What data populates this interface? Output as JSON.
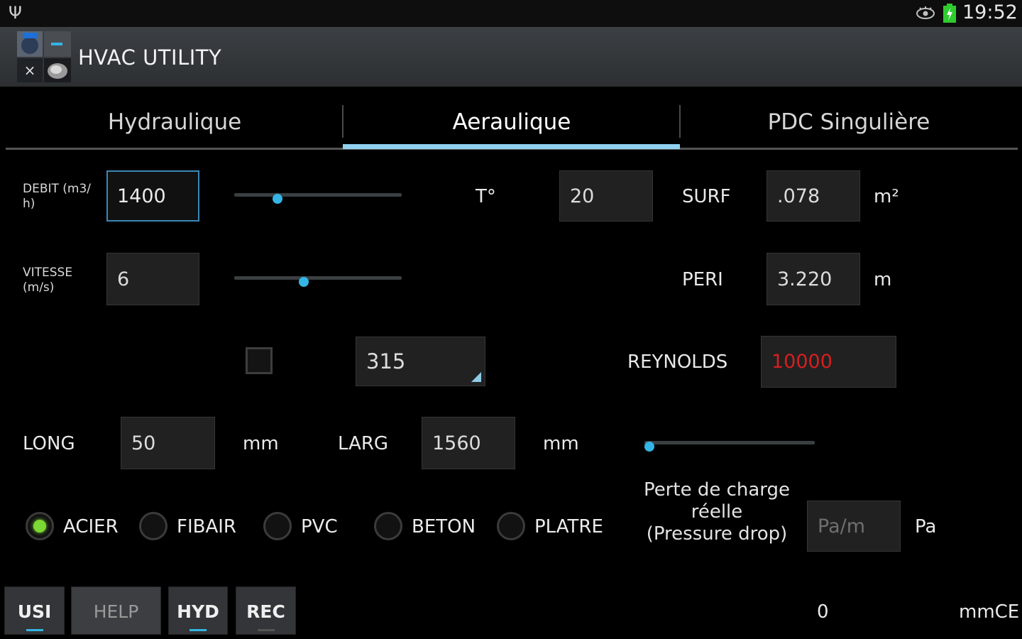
{
  "status": {
    "usb_icon": "usb-icon",
    "clock": "19:52"
  },
  "app": {
    "title": "HVAC UTILITY"
  },
  "tabs": [
    {
      "label": "Hydraulique",
      "active": false
    },
    {
      "label": "Aeraulique",
      "active": true
    },
    {
      "label": "PDC Singulière",
      "active": false
    }
  ],
  "debit": {
    "label": "DEBIT (m3/ h)",
    "value": "1400"
  },
  "vitesse": {
    "label": "VITESSE (m/s)",
    "value": "6"
  },
  "temperature": {
    "label": "T°",
    "value": "20"
  },
  "surf": {
    "label": "SURF",
    "value": ".078",
    "unit": "m²"
  },
  "peri": {
    "label": "PERI",
    "value": "3.220",
    "unit": "m"
  },
  "diameter": {
    "value": "315",
    "checked": false
  },
  "reynolds": {
    "label": "REYNOLDS",
    "value": "10000",
    "value_color": "#d61f1f"
  },
  "long": {
    "label": "LONG",
    "value": "50",
    "unit": "mm"
  },
  "larg": {
    "label": "LARG",
    "value": "1560",
    "unit": "mm"
  },
  "materials": [
    {
      "label": "ACIER",
      "selected": true
    },
    {
      "label": "FIBAIR",
      "selected": false
    },
    {
      "label": "PVC",
      "selected": false
    },
    {
      "label": "BETON",
      "selected": false
    },
    {
      "label": "PLATRE",
      "selected": false
    }
  ],
  "pressure_drop": {
    "label_line1": "Perte de charge",
    "label_line2": "réelle",
    "label_line3": "(Pressure drop)",
    "placeholder": "Pa/m",
    "unit": "Pa"
  },
  "buttons": {
    "usi": "USI",
    "help": "HELP",
    "hyd": "HYD",
    "rec": "REC"
  },
  "footer": {
    "value": "0",
    "unit": "mmCE"
  },
  "sliders": {
    "debit_level": 0.13,
    "vitesse_level": 0.3,
    "larg_level": 0.0
  },
  "colors": {
    "accent": "#33b5e5",
    "tab_indicator": "#8fd1ef",
    "radio_on": "#7cd834"
  }
}
